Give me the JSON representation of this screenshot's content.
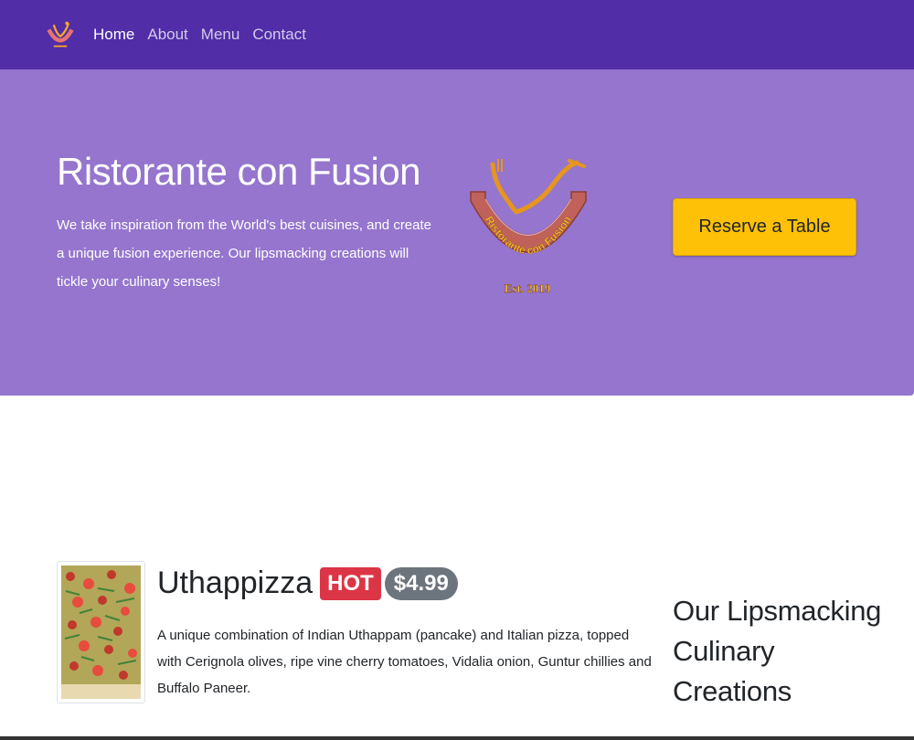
{
  "navbar": {
    "logo_icon": "restaurant-logo-icon",
    "links": [
      {
        "label": "Home",
        "active": true
      },
      {
        "label": "About",
        "active": false
      },
      {
        "label": "Menu",
        "active": false
      },
      {
        "label": "Contact",
        "active": false
      }
    ]
  },
  "hero": {
    "title": "Ristorante con Fusion",
    "description": "We take inspiration from the World's best cuisines, and create a unique fusion experience. Our lipsmacking creations will tickle your culinary senses!",
    "logo_text": "Ristorante con Fusion",
    "logo_est": "Est. 2019",
    "reserve_label": "Reserve a Table"
  },
  "dish": {
    "name": "Uthappizza",
    "badge": "HOT",
    "price": "$4.99",
    "description": "A unique combination of Indian Uthappam (pancake) and Italian pizza, topped with Cerignola olives, ripe vine cherry tomatoes, Vidalia onion, Guntur chillies and Buffalo Paneer.",
    "image_icon": "pizza-image"
  },
  "side": {
    "title": "Our Lipsmacking Culinary Creations"
  },
  "colors": {
    "navbar": "#512da8",
    "jumbotron": "#9575cd",
    "reserve": "#ffc107",
    "hot_badge": "#dc3545",
    "price_badge": "#6c757d"
  }
}
